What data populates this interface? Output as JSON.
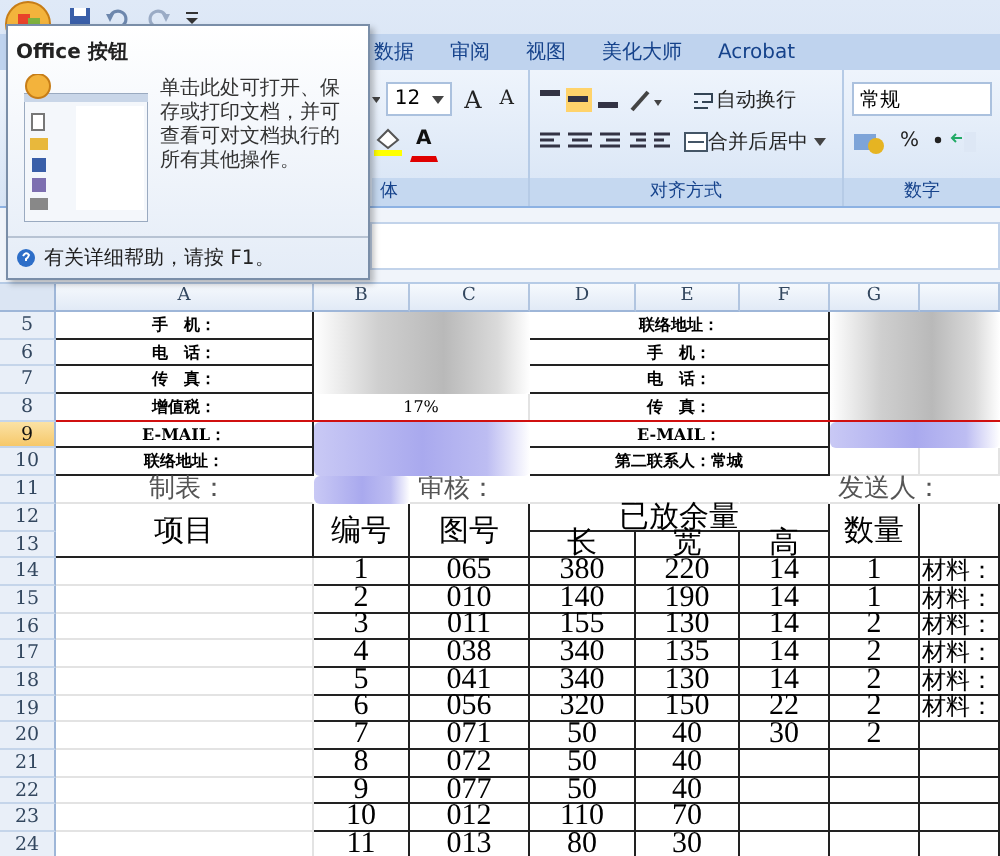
{
  "tooltip": {
    "title": "Office 按钮",
    "description": "单击此处可打开、保存或打印文档，并可查看可对文档执行的所有其他操作。",
    "help": "有关详细帮助，请按 F1。"
  },
  "ribbon": {
    "tabs": [
      {
        "label": "数据",
        "selected": false
      },
      {
        "label": "审阅",
        "selected": false
      },
      {
        "label": "视图",
        "selected": false
      },
      {
        "label": "美化大师",
        "selected": false
      },
      {
        "label": "Acrobat",
        "selected": false
      }
    ],
    "font_size": "12",
    "grow_font": "A",
    "shrink_font": "A",
    "font_color": "A",
    "font_group_label": "体",
    "align_group_label": "对齐方式",
    "wrap_text": "自动换行",
    "merge_center": "合并后居中",
    "number_format": "常规",
    "percent": "%",
    "number_group_label": "数字"
  },
  "sheet": {
    "columns": [
      "A",
      "B",
      "C",
      "D",
      "E",
      "F",
      "G"
    ],
    "rows": [
      {
        "number": "5",
        "selected": false,
        "cells": [
          "手　机：",
          "",
          "",
          "联络地址：",
          "",
          "",
          "",
          ""
        ]
      },
      {
        "number": "6",
        "selected": false,
        "cells": [
          "电　话：",
          "",
          "",
          "手　机：",
          "",
          "",
          "",
          ""
        ]
      },
      {
        "number": "7",
        "selected": false,
        "cells": [
          "传　真：",
          "",
          "",
          "电　话：",
          "",
          "",
          "",
          ""
        ]
      },
      {
        "number": "8",
        "selected": false,
        "cells": [
          "增值税：",
          "17%",
          "",
          "传　真：",
          "",
          "",
          "",
          ""
        ]
      },
      {
        "number": "9",
        "selected": true,
        "cells": [
          "E-MAIL：",
          "",
          "",
          "E-MAIL：",
          "",
          "",
          "",
          ""
        ]
      },
      {
        "number": "10",
        "selected": false,
        "cells": [
          "联络地址：",
          "",
          "",
          "第二联系人：常城",
          "",
          "",
          "",
          ""
        ]
      },
      {
        "number": "11",
        "selected": false,
        "cells": [
          "制表：",
          "",
          "审核：",
          "",
          "",
          "",
          "发送人：",
          ""
        ]
      },
      {
        "number": "12",
        "selected": false,
        "cells": [
          "项目",
          "编号",
          "图号",
          "已放余量",
          "",
          "",
          "数量",
          ""
        ]
      },
      {
        "number": "13",
        "selected": false,
        "cells": [
          "",
          "",
          "",
          "长",
          "宽",
          "高",
          "",
          ""
        ]
      },
      {
        "number": "14",
        "selected": false,
        "cells": [
          "",
          "1",
          "065",
          "380",
          "220",
          "14",
          "1",
          "材料："
        ]
      },
      {
        "number": "15",
        "selected": false,
        "cells": [
          "",
          "2",
          "010",
          "140",
          "190",
          "14",
          "1",
          "材料："
        ]
      },
      {
        "number": "16",
        "selected": false,
        "cells": [
          "",
          "3",
          "011",
          "155",
          "130",
          "14",
          "2",
          "材料："
        ]
      },
      {
        "number": "17",
        "selected": false,
        "cells": [
          "",
          "4",
          "038",
          "340",
          "135",
          "14",
          "2",
          "材料："
        ]
      },
      {
        "number": "18",
        "selected": false,
        "cells": [
          "",
          "5",
          "041",
          "340",
          "130",
          "14",
          "2",
          "材料："
        ]
      },
      {
        "number": "19",
        "selected": false,
        "cells": [
          "",
          "6",
          "056",
          "320",
          "150",
          "22",
          "2",
          "材料："
        ]
      },
      {
        "number": "20",
        "selected": false,
        "cells": [
          "",
          "7",
          "071",
          "50",
          "40",
          "30",
          "2",
          ""
        ]
      },
      {
        "number": "21",
        "selected": false,
        "cells": [
          "",
          "8",
          "072",
          "50",
          "40",
          "",
          "",
          ""
        ]
      },
      {
        "number": "22",
        "selected": false,
        "cells": [
          "",
          "9",
          "077",
          "50",
          "40",
          "",
          "",
          ""
        ]
      },
      {
        "number": "23",
        "selected": false,
        "cells": [
          "",
          "10",
          "012",
          "110",
          "70",
          "",
          "",
          ""
        ]
      },
      {
        "number": "24",
        "selected": false,
        "cells": [
          "",
          "11",
          "013",
          "80",
          "30",
          "",
          "",
          ""
        ]
      }
    ]
  }
}
